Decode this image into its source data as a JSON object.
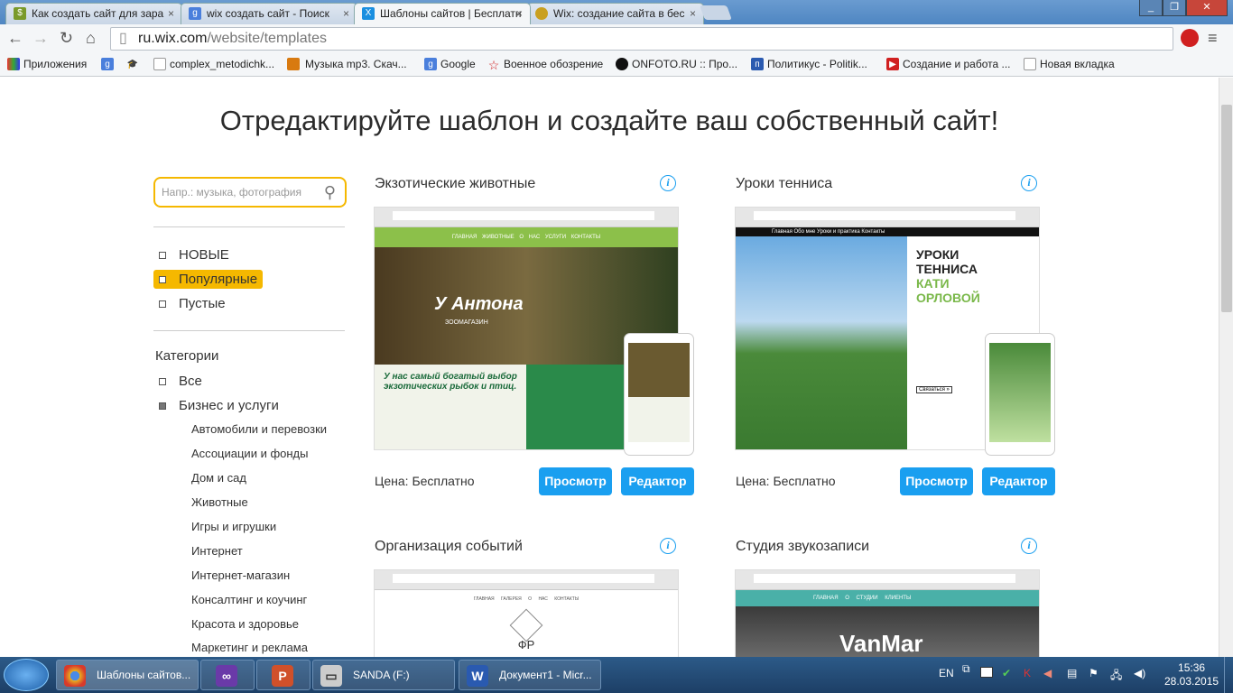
{
  "browser": {
    "tabs": [
      {
        "title": "Как создать сайт для зара",
        "icon": "dollar-icon",
        "color": "#7a9a2a"
      },
      {
        "title": "wix создать сайт - Поиск",
        "icon": "google-icon",
        "color": "#4a7fdc"
      },
      {
        "title": "Шаблоны сайтов | Бесплатн",
        "icon": "wix-icon",
        "color": "#1a8fe0"
      },
      {
        "title": "Wix: создание сайта в бес",
        "icon": "globe-icon",
        "color": "#c9a020"
      }
    ],
    "close_glyph": "×",
    "url_host": "ru.wix.com",
    "url_path": "/website/templates",
    "bookmarks": [
      "Приложения",
      "",
      "",
      "complex_metodichk...",
      "Музыка mp3. Скач...",
      "Google",
      "Военное обозрение",
      "ONFOTO.RU :: Про...",
      "Политикус - Politik...",
      "Создание и работа ...",
      "Новая вкладка"
    ]
  },
  "page": {
    "heading": "Отредактируйте шаблон и создайте ваш собственный сайт!",
    "search_placeholder": "Напр.: музыка, фотография",
    "filters": [
      "НОВЫЕ",
      "Популярные",
      "Пустые"
    ],
    "selected_filter": "Популярные",
    "categories_title": "Категории",
    "categories": [
      "Все",
      "Бизнес и услуги"
    ],
    "subcategories": [
      "Автомобили и перевозки",
      "Ассоциации и фонды",
      "Дом и сад",
      "Животные",
      "Игры и игрушки",
      "Интернет",
      "Интернет-магазин",
      "Консалтинг и коучинг",
      "Красота и здоровье",
      "Маркетинг и реклама"
    ],
    "price_label": "Цена: Бесплатно",
    "preview_label": "Просмотр",
    "editor_label": "Редактор",
    "info_glyph": "i",
    "templates": [
      {
        "title": "Экзотические животные",
        "nav": "ГЛАВНАЯ   ЖИВОТНЫЕ   О НАС   УСЛУГИ   КОНТАКТЫ",
        "brand": "У Антона",
        "sub": "ЗООМАГАЗИН",
        "tagline": "У нас самый богатый выбор экзотических рыбок и птиц."
      },
      {
        "title": "Уроки тенниса",
        "nav": "Главная  Обо мне  Уроки и практика  Контакты",
        "brand": "УРОКИ ТЕННИСА",
        "sub": "КАТИ ОРЛОВОЙ",
        "tagline": "Связаться »"
      },
      {
        "title": "Организация событий",
        "nav": "ГЛАВНАЯ  ГАЛЕРЕЯ  О НАС  КОНТАКТЫ",
        "brand": "ФР"
      },
      {
        "title": "Студия звукозаписи",
        "nav": "ГЛАВНАЯ   О СТУДИИ   КЛИЕНТЫ",
        "brand": "VanMar"
      }
    ]
  },
  "taskbar": {
    "items": [
      "Шаблоны сайтов...",
      "",
      "",
      "SANDA (F:)",
      "Документ1 - Micr..."
    ],
    "lang": "EN",
    "time": "15:36",
    "date": "28.03.2015"
  }
}
